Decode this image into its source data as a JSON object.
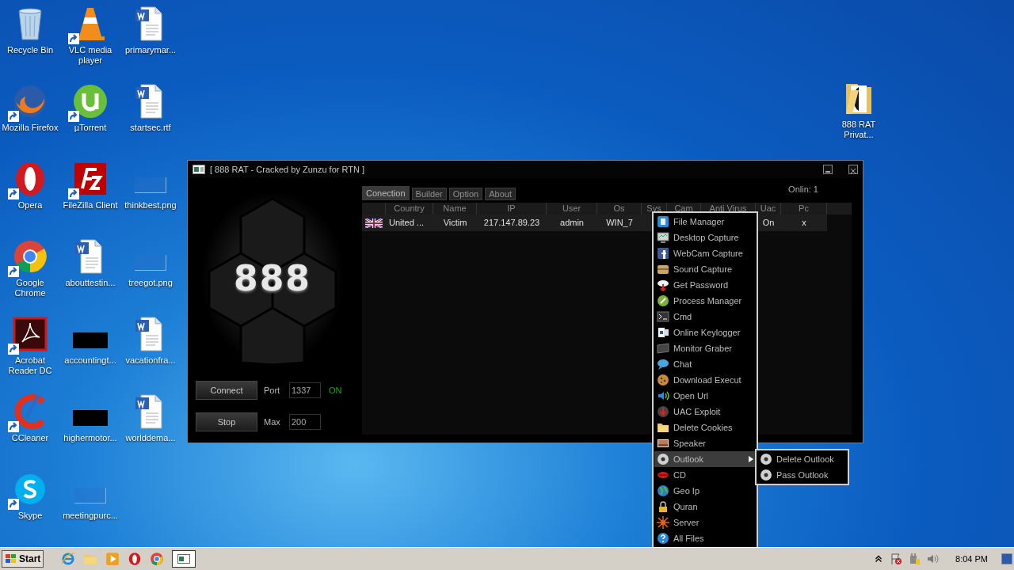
{
  "desktop_icons": [
    [
      {
        "label": "Recycle Bin",
        "shortcut": false
      },
      {
        "label": "Mozilla Firefox",
        "shortcut": true
      },
      {
        "label": "Opera",
        "shortcut": true
      },
      {
        "label": "Google Chrome",
        "shortcut": true
      },
      {
        "label": "Acrobat Reader DC",
        "shortcut": true
      },
      {
        "label": "CCleaner",
        "shortcut": true
      },
      {
        "label": "Skype",
        "shortcut": true
      }
    ],
    [
      {
        "label": "VLC media player",
        "shortcut": true
      },
      {
        "label": "µTorrent",
        "shortcut": true
      },
      {
        "label": "FileZilla Client",
        "shortcut": true
      },
      {
        "label": "abouttestin...",
        "shortcut": false
      },
      {
        "label": "accountingt...",
        "shortcut": false
      },
      {
        "label": "highermotor...",
        "shortcut": false
      },
      {
        "label": "meetingpurc...",
        "shortcut": false
      }
    ],
    [
      {
        "label": "primarymar...",
        "shortcut": false
      },
      {
        "label": "startsec.rtf",
        "shortcut": false
      },
      {
        "label": "thinkbest.png",
        "shortcut": false
      },
      {
        "label": "treegot.png",
        "shortcut": false
      },
      {
        "label": "vacationfra...",
        "shortcut": false
      },
      {
        "label": "worlddema...",
        "shortcut": false
      }
    ]
  ],
  "desktop_icon_right": {
    "label": "888 RAT Privat...",
    "shortcut": false
  },
  "window": {
    "title": "[  888 RAT - Cracked by Zunzu for RTN ]",
    "logo": "888",
    "connect_button": "Connect",
    "stop_button": "Stop",
    "port": {
      "label": "Port",
      "value": "1337"
    },
    "status": "ON",
    "max": {
      "label": "Max",
      "value": "200"
    },
    "tabs": [
      {
        "label": "Conection",
        "selected": true
      },
      {
        "label": "Builder",
        "selected": false
      },
      {
        "label": "Option",
        "selected": false
      },
      {
        "label": "About",
        "selected": false
      }
    ],
    "online": "Onlin: 1",
    "table": {
      "columns": [
        "",
        "Country",
        "Name",
        "IP",
        "User",
        "Os",
        "Sys",
        "Cam",
        "Anti Virus",
        "Uac",
        "Pc"
      ],
      "rows": [
        {
          "country": "United ...",
          "name": "Victim",
          "ip": "217.147.89.23",
          "user": "admin",
          "os": "WIN_7",
          "uac": "On",
          "pc": "x"
        }
      ]
    }
  },
  "context_menu": {
    "items": [
      {
        "label": "File Manager",
        "selected": false,
        "submenu": false
      },
      {
        "label": "Desktop Capture",
        "selected": false,
        "submenu": false
      },
      {
        "label": "WebCam Capture",
        "selected": false,
        "submenu": false
      },
      {
        "label": "Sound Capture",
        "selected": false,
        "submenu": false
      },
      {
        "label": "Get Password",
        "selected": false,
        "submenu": false
      },
      {
        "label": "Process Manager",
        "selected": false,
        "submenu": false
      },
      {
        "label": "Cmd",
        "selected": false,
        "submenu": false
      },
      {
        "label": "Online Keylogger",
        "selected": false,
        "submenu": false
      },
      {
        "label": "Monitor Graber",
        "selected": false,
        "submenu": false
      },
      {
        "label": "Chat",
        "selected": false,
        "submenu": false
      },
      {
        "label": "Download Execut",
        "selected": false,
        "submenu": false
      },
      {
        "label": "Open Url",
        "selected": false,
        "submenu": false
      },
      {
        "label": "UAC Exploit",
        "selected": false,
        "submenu": false
      },
      {
        "label": "Delete Cookies",
        "selected": false,
        "submenu": false
      },
      {
        "label": "Speaker",
        "selected": false,
        "submenu": false
      },
      {
        "label": "Outlook",
        "selected": true,
        "submenu": true
      },
      {
        "label": "CD",
        "selected": false,
        "submenu": false
      },
      {
        "label": "Geo Ip",
        "selected": false,
        "submenu": false
      },
      {
        "label": "Quran",
        "selected": false,
        "submenu": false
      },
      {
        "label": "Server",
        "selected": false,
        "submenu": false
      },
      {
        "label": "All Files",
        "selected": false,
        "submenu": false
      }
    ],
    "submenu": [
      "Delete Outlook",
      "Pass Outlook"
    ]
  },
  "taskbar": {
    "start": "Start",
    "active_window": {
      "selected": true
    },
    "clock": "8:04 PM"
  }
}
